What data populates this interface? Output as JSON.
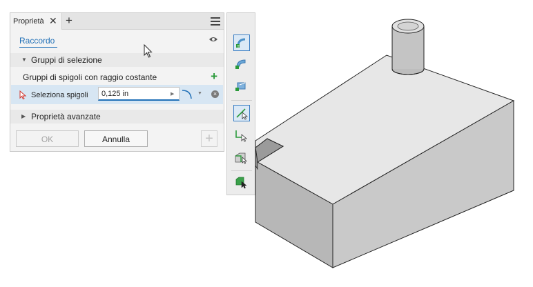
{
  "panel": {
    "tab_label": "Proprietà",
    "tab_close_glyph": "✕",
    "tab_add_glyph": "+",
    "menu_icon": "hamburger-menu-icon",
    "feature_name": "Raccordo",
    "visibility_icon": "eye-icon"
  },
  "sections": {
    "selection_groups": "Gruppi di selezione",
    "advanced": "Proprietà avanzate"
  },
  "edge_groups": {
    "label": "Gruppi di spigoli con raggio costante",
    "add_glyph": "+"
  },
  "selection_row": {
    "label": "Seleziona spigoli",
    "value": "0,125 in",
    "clear_glyph": "×"
  },
  "buttons": {
    "ok": "OK",
    "cancel": "Annulla",
    "add_glyph": "+"
  },
  "toolbar": {
    "tools": [
      {
        "icon": "fillet-edge-icon",
        "active": true
      },
      {
        "icon": "fillet-face-icon",
        "active": false
      },
      {
        "icon": "full-round-fillet-icon",
        "active": false
      },
      {
        "icon": "select-edge-icon",
        "active": true
      },
      {
        "icon": "select-loop-icon",
        "active": false
      },
      {
        "icon": "select-feature-icon",
        "active": false
      },
      {
        "icon": "select-all-icon",
        "active": false
      }
    ]
  },
  "colors": {
    "accent": "#1f6fb7",
    "add_green": "#2a9a3a",
    "selected_row": "#d7e6f3"
  }
}
